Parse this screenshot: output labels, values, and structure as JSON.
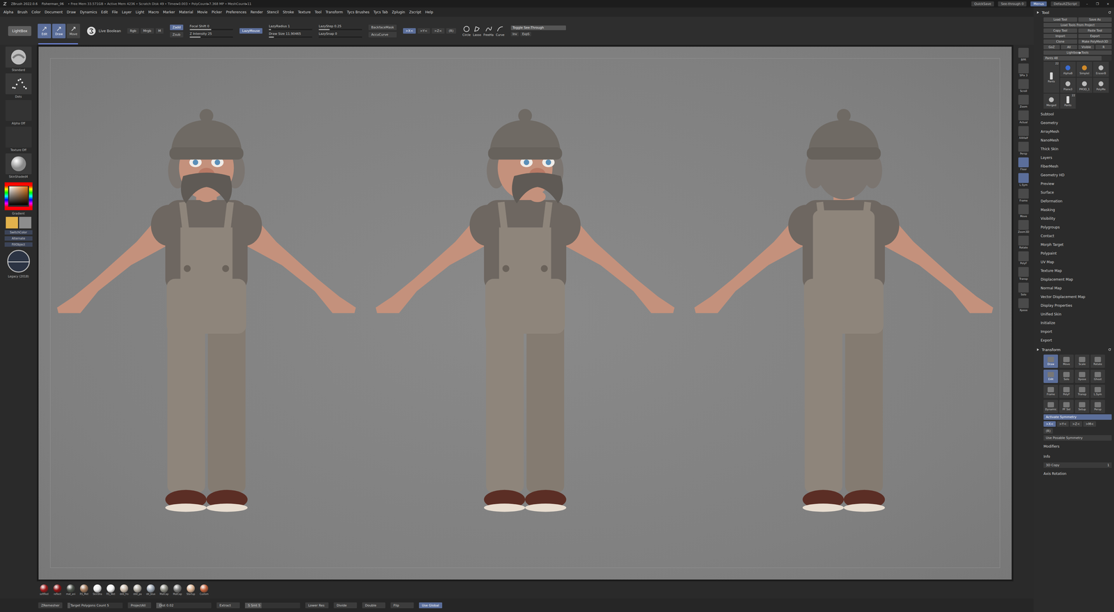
{
  "titleBar": {
    "app": "ZBrush 2022.0.6",
    "file": "Fisherman_06",
    "stats": "• Free Mem 33.571GB • Active Mem 4236 • Scratch Disk 49 • Timer▸0.003 • PolyCount▸7.368 MP • MeshCount▸11",
    "buttons": [
      {
        "label": "QuickSave",
        "selected": false
      },
      {
        "label": "See-through 0",
        "selected": false
      },
      {
        "label": "Menus",
        "selected": true
      },
      {
        "label": "DefaultZScript",
        "selected": false
      }
    ],
    "controls": [
      "–",
      "❐",
      "×"
    ]
  },
  "menu": [
    "Alpha",
    "Brush",
    "Color",
    "Document",
    "Draw",
    "Dynamics",
    "Edit",
    "File",
    "Layer",
    "Light",
    "Macro",
    "Marker",
    "Material",
    "Movie",
    "Picker",
    "Preferences",
    "Render",
    "Stencil",
    "Stroke",
    "Texture",
    "Tool",
    "Transform",
    "Tycs Brushes",
    "Tycs Tab",
    "Zplugin",
    "Zscript",
    "Help"
  ],
  "topShelf": {
    "lightbox": "LightBox",
    "modes": [
      {
        "label": "Edit",
        "selected": true
      },
      {
        "label": "Draw",
        "selected": true
      },
      {
        "label": "Move",
        "selected": false
      }
    ],
    "liveBoolean": "Live Boolean",
    "colorModes": [
      {
        "label": "Rgb",
        "selected": false
      },
      {
        "label": "Mrgb",
        "selected": false
      },
      {
        "label": "M",
        "selected": false
      }
    ],
    "zModes": [
      {
        "label": "Zadd",
        "selected": true
      },
      {
        "label": "Zsub",
        "selected": false
      }
    ],
    "sliders": [
      {
        "label": "Focal Shift",
        "value": "0",
        "level": 0.5
      },
      {
        "label": "Z Intensity",
        "value": "25",
        "level": 0.25
      }
    ],
    "lazyMouse": {
      "label": "LazyMouse",
      "selected": true
    },
    "lazySliders": [
      {
        "label": "LazyRadius",
        "value": "1",
        "level": 0.05
      },
      {
        "label": "Draw Size",
        "value": "11.90465",
        "level": 0.12
      }
    ],
    "stepSliders": [
      {
        "label": "LazyStep",
        "value": "0.25",
        "level": 0.25
      },
      {
        "label": "LazySnap",
        "value": "0",
        "level": 0
      }
    ],
    "toggles": [
      {
        "label": "BackfaceMask",
        "selected": false
      },
      {
        "label": "AccuCurve",
        "selected": false
      }
    ],
    "symmetry": [
      {
        "label": ">X<",
        "selected": true
      },
      {
        "label": ">Y<",
        "selected": false
      },
      {
        "label": ">Z<",
        "selected": false
      },
      {
        "label": "(R)",
        "selected": false
      }
    ],
    "strokes": [
      {
        "label": "Circle",
        "selected": false
      },
      {
        "label": "Lasso",
        "selected": false
      },
      {
        "label": "FreeHa",
        "selected": false
      },
      {
        "label": "Curve",
        "selected": false
      }
    ],
    "seeThrough": {
      "label": "Toggle See-Through",
      "level": 0
    },
    "extras": [
      "Inv",
      "ExpS"
    ]
  },
  "progress": {
    "level": 0.04
  },
  "leftShelf": {
    "brush": "Standard",
    "stroke": "Dots",
    "alpha": "Alpha Off",
    "texture": "Texture Off",
    "material": "SkinShaded4",
    "gradient": "Gradient",
    "mainColor": "#e2b24c",
    "secondaryColor": "#8d8d8d",
    "buttons": [
      "SwitchColor",
      "Alternate",
      "FillObject"
    ],
    "renderMode": "Legacy (2018)"
  },
  "viewport": {
    "figures": [
      {
        "kind": "front"
      },
      {
        "kind": "three-quarter"
      },
      {
        "kind": "back"
      }
    ]
  },
  "rightShelf": [
    {
      "label": "BPR",
      "selected": false
    },
    {
      "label": "SPix 3",
      "selected": false
    },
    {
      "label": "Scroll",
      "selected": false
    },
    {
      "label": "Zoom",
      "selected": false
    },
    {
      "label": "Actual",
      "selected": false
    },
    {
      "label": "AAHalf",
      "selected": false
    },
    {
      "label": "Persp",
      "selected": false
    },
    {
      "label": "Floor",
      "selected": true
    },
    {
      "label": "L.Sym",
      "selected": true
    },
    {
      "label": "Frame",
      "selected": false
    },
    {
      "label": "Move",
      "selected": false
    },
    {
      "label": "Zoom3D",
      "selected": false
    },
    {
      "label": "Rotate",
      "selected": false
    },
    {
      "label": "PolyF",
      "selected": false
    },
    {
      "label": "Transp",
      "selected": false
    },
    {
      "label": "Solo",
      "selected": false
    },
    {
      "label": "Xpose",
      "selected": false
    }
  ],
  "materials": [
    {
      "label": "softRed",
      "color": "#9a1a1a"
    },
    {
      "label": "reflect",
      "color": "#8c1414"
    },
    {
      "label": "mat_ani",
      "color": "#4a5048"
    },
    {
      "label": "RS_Met",
      "color": "#a0785a"
    },
    {
      "label": "SkinSha",
      "color": "#e8e8e8"
    },
    {
      "label": "RS_Wet",
      "color": "#f2f2f2"
    },
    {
      "label": "ddd_fro",
      "color": "#c8b8a8"
    },
    {
      "label": "ddd_pa",
      "color": "#b0aaa0"
    },
    {
      "label": "dd_blue",
      "color": "#9aa4b0"
    },
    {
      "label": "MatCap",
      "color": "#8a8a80"
    },
    {
      "label": "MatCap",
      "color": "#7a7a78"
    },
    {
      "label": "Startup",
      "color": "#d8b090"
    },
    {
      "label": "Custom",
      "color": "#c0603a"
    }
  ],
  "bottomBar": [
    {
      "label": "ZRemesher",
      "kind": "button",
      "selected": false,
      "level": 0
    },
    {
      "label": "Target Polygons Count 5",
      "kind": "slider",
      "selected": false,
      "level": 0.05
    },
    {
      "label": "ProjectAll",
      "kind": "button",
      "selected": false,
      "level": 0
    },
    {
      "label": "Dist 0.02",
      "kind": "slider",
      "selected": false,
      "level": 0.1
    },
    {
      "label": "Extract",
      "kind": "button",
      "selected": false,
      "level": 0
    },
    {
      "label": "S Smt 5",
      "kind": "slider",
      "selected": false,
      "level": 0.3
    },
    {
      "label": "Lower Res",
      "kind": "button",
      "selected": false,
      "level": 0
    },
    {
      "label": "Divide",
      "kind": "button",
      "selected": false,
      "level": 0
    },
    {
      "label": "Double",
      "kind": "button",
      "selected": false,
      "level": 0
    },
    {
      "label": "Flip",
      "kind": "button",
      "selected": false,
      "level": 0
    },
    {
      "label": "Use Global",
      "kind": "button",
      "selected": true,
      "level": 0
    }
  ],
  "tray": {
    "title": "Tool",
    "buttonRows": [
      [
        "Load Tool",
        "Save As"
      ],
      [
        "Load Tools From Project"
      ],
      [
        "Copy Tool",
        "Paste Tool"
      ],
      [
        "Import",
        "Export"
      ],
      [
        "Clone",
        "Make PolyMesh3D"
      ],
      [
        "GoZ",
        "All",
        "Visible",
        "R"
      ],
      [
        "Lightbox▶Tools"
      ]
    ],
    "toolSlider": {
      "label": "Pants",
      "value": "48",
      "level": 0.85
    },
    "thumbnails": [
      {
        "label": "Pants",
        "badge": "22"
      },
      {
        "label": "AlphaB",
        "badge": ""
      },
      {
        "label": "SimpleI",
        "badge": ""
      },
      {
        "label": "EraserB",
        "badge": ""
      },
      {
        "label": "Plane3",
        "badge": ""
      },
      {
        "label": "PM3D_1",
        "badge": ""
      },
      {
        "label": "PolyMe",
        "badge": ""
      },
      {
        "label": "Merged",
        "badge": ""
      },
      {
        "label": "Pants",
        "badge": "22"
      }
    ],
    "sections": [
      "Subtool",
      "Geometry",
      "ArrayMesh",
      "NanoMesh",
      "Thick Skin",
      "Layers",
      "FiberMesh",
      "Geometry HD",
      "Preview",
      "Surface",
      "Deformation",
      "Masking",
      "Visibility",
      "Polygroups",
      "Contact",
      "Morph Target",
      "Polypaint",
      "UV Map",
      "Texture Map",
      "Displacement Map",
      "Normal Map",
      "Vector Displacement Map",
      "Display Properties",
      "Unified Skin",
      "Initialize",
      "Import",
      "Export"
    ]
  },
  "transform": {
    "title": "Transform",
    "rows": [
      [
        {
          "label": "Draw",
          "selected": true
        },
        {
          "label": "Move",
          "selected": false
        },
        {
          "label": "Scale",
          "selected": false
        },
        {
          "label": "Rotate",
          "selected": false
        }
      ],
      [
        {
          "label": "Edit",
          "selected": true
        },
        {
          "label": "Solo",
          "selected": false
        },
        {
          "label": "Xpose",
          "selected": false
        },
        {
          "label": "Ghost",
          "selected": false
        }
      ],
      [
        {
          "label": "Frame",
          "selected": false
        },
        {
          "label": "PolyF",
          "selected": false
        },
        {
          "label": "Transp",
          "selected": false
        },
        {
          "label": "L.Sym",
          "selected": false
        }
      ],
      [
        {
          "label": "Dynamic",
          "selected": false
        },
        {
          "label": "PF Sel",
          "selected": false
        },
        {
          "label": "Setup",
          "selected": false
        },
        {
          "label": "Persp",
          "selected": false
        }
      ]
    ],
    "activateSymmetry": {
      "label": "Activate Symmetry",
      "selected": true
    },
    "axes": [
      {
        "label": ">X<",
        "selected": true
      },
      {
        "label": ">Y<",
        "selected": false
      },
      {
        "label": ">Z<",
        "selected": false
      },
      {
        "label": ">M<",
        "selected": false
      }
    ],
    "radial": {
      "label": "(R)",
      "selected": false
    },
    "posable": {
      "label": "Use Posable Symmetry",
      "selected": false
    },
    "footer": [
      "Modifiers",
      "Info"
    ],
    "copy": {
      "label": "3D Copy",
      "value": "1"
    },
    "axisRotation": "Axis Rotation"
  }
}
